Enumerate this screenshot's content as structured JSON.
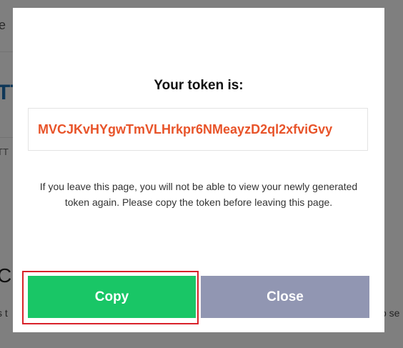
{
  "background": {
    "fragment_top": "e",
    "fragment_title": "TT",
    "fragment_small": "TT",
    "fragment_heading": "C",
    "fragment_left": "s t",
    "fragment_right": "o se"
  },
  "modal": {
    "title": "Your token is:",
    "token": "MVCJKvHYgwTmVLHrkpr6NMeayzD2ql2xfviGvy",
    "warning": "If you leave this page, you will not be able to view your newly generated token again. Please copy the token before leaving this page.",
    "copy_label": "Copy",
    "close_label": "Close"
  },
  "colors": {
    "token": "#e8542a",
    "copy_button": "#19c666",
    "close_button": "#9196b2",
    "highlight": "#d9222a"
  }
}
